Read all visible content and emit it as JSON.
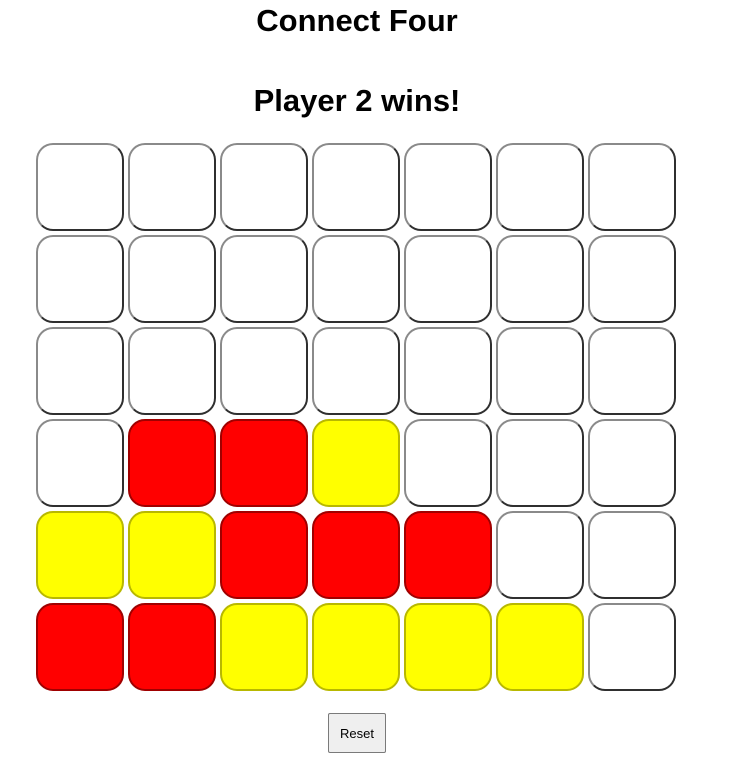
{
  "title": "Connect Four",
  "status": "Player 2 wins!",
  "colors": {
    "player1": "#ff0000",
    "player2": "#ffff00",
    "empty": "#ffffff"
  },
  "board": {
    "columns": 7,
    "rows": 6,
    "cells": [
      [
        "empty",
        "empty",
        "empty",
        "empty",
        "empty",
        "empty",
        "empty"
      ],
      [
        "empty",
        "empty",
        "empty",
        "empty",
        "empty",
        "empty",
        "empty"
      ],
      [
        "empty",
        "empty",
        "empty",
        "empty",
        "empty",
        "empty",
        "empty"
      ],
      [
        "empty",
        "red",
        "red",
        "yellow",
        "empty",
        "empty",
        "empty"
      ],
      [
        "yellow",
        "yellow",
        "red",
        "red",
        "red",
        "empty",
        "empty"
      ],
      [
        "red",
        "red",
        "yellow",
        "yellow",
        "yellow",
        "yellow",
        "empty"
      ]
    ]
  },
  "controls": {
    "reset_label": "Reset"
  }
}
